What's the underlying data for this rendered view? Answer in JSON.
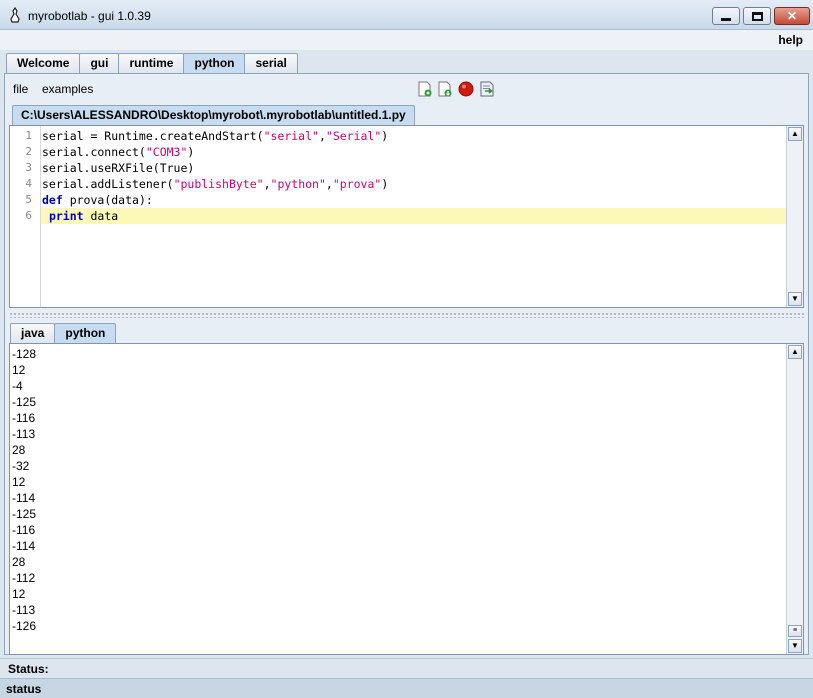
{
  "window": {
    "title": "myrobotlab - gui 1.0.39"
  },
  "menubar": {
    "help": "help"
  },
  "main_tabs": [
    {
      "label": "Welcome"
    },
    {
      "label": "gui"
    },
    {
      "label": "runtime"
    },
    {
      "label": "python",
      "active": true
    },
    {
      "label": "serial"
    }
  ],
  "python_menu": {
    "file": "file",
    "examples": "examples"
  },
  "toolbar": {
    "icons": [
      "new-script-icon",
      "load-script-icon",
      "stop-icon",
      "execute-icon"
    ]
  },
  "file_tab": {
    "label": "C:\\Users\\ALESSANDRO\\Desktop\\myrobot\\.myrobotlab\\untitled.1.py"
  },
  "editor": {
    "line_numbers": [
      "1",
      "2",
      "3",
      "4",
      "5",
      "6"
    ],
    "lines": [
      "serial = Runtime.createAndStart(\"serial\",\"Serial\")",
      "serial.connect(\"COM3\")",
      "serial.useRXFile(True)",
      "serial.addListener(\"publishByte\",\"python\",\"prova\")",
      "def prova(data):",
      " print data"
    ],
    "highlighted_line": 6
  },
  "output_tabs": [
    {
      "label": "java"
    },
    {
      "label": "python",
      "active": true
    }
  ],
  "console": {
    "lines": [
      "-128",
      "12",
      "-4",
      "-125",
      "-116",
      "-113",
      "28",
      "-32",
      "12",
      "-114",
      "-125",
      "-116",
      "-114",
      "28",
      "-112",
      "12",
      "-113",
      "-126"
    ]
  },
  "status": {
    "label": "Status:",
    "bar": "status"
  },
  "colors": {
    "keyword": "#0000cc",
    "string": "#cc0077",
    "current_line": "#fbf8b8",
    "active_tab": "#c7dcf0"
  }
}
